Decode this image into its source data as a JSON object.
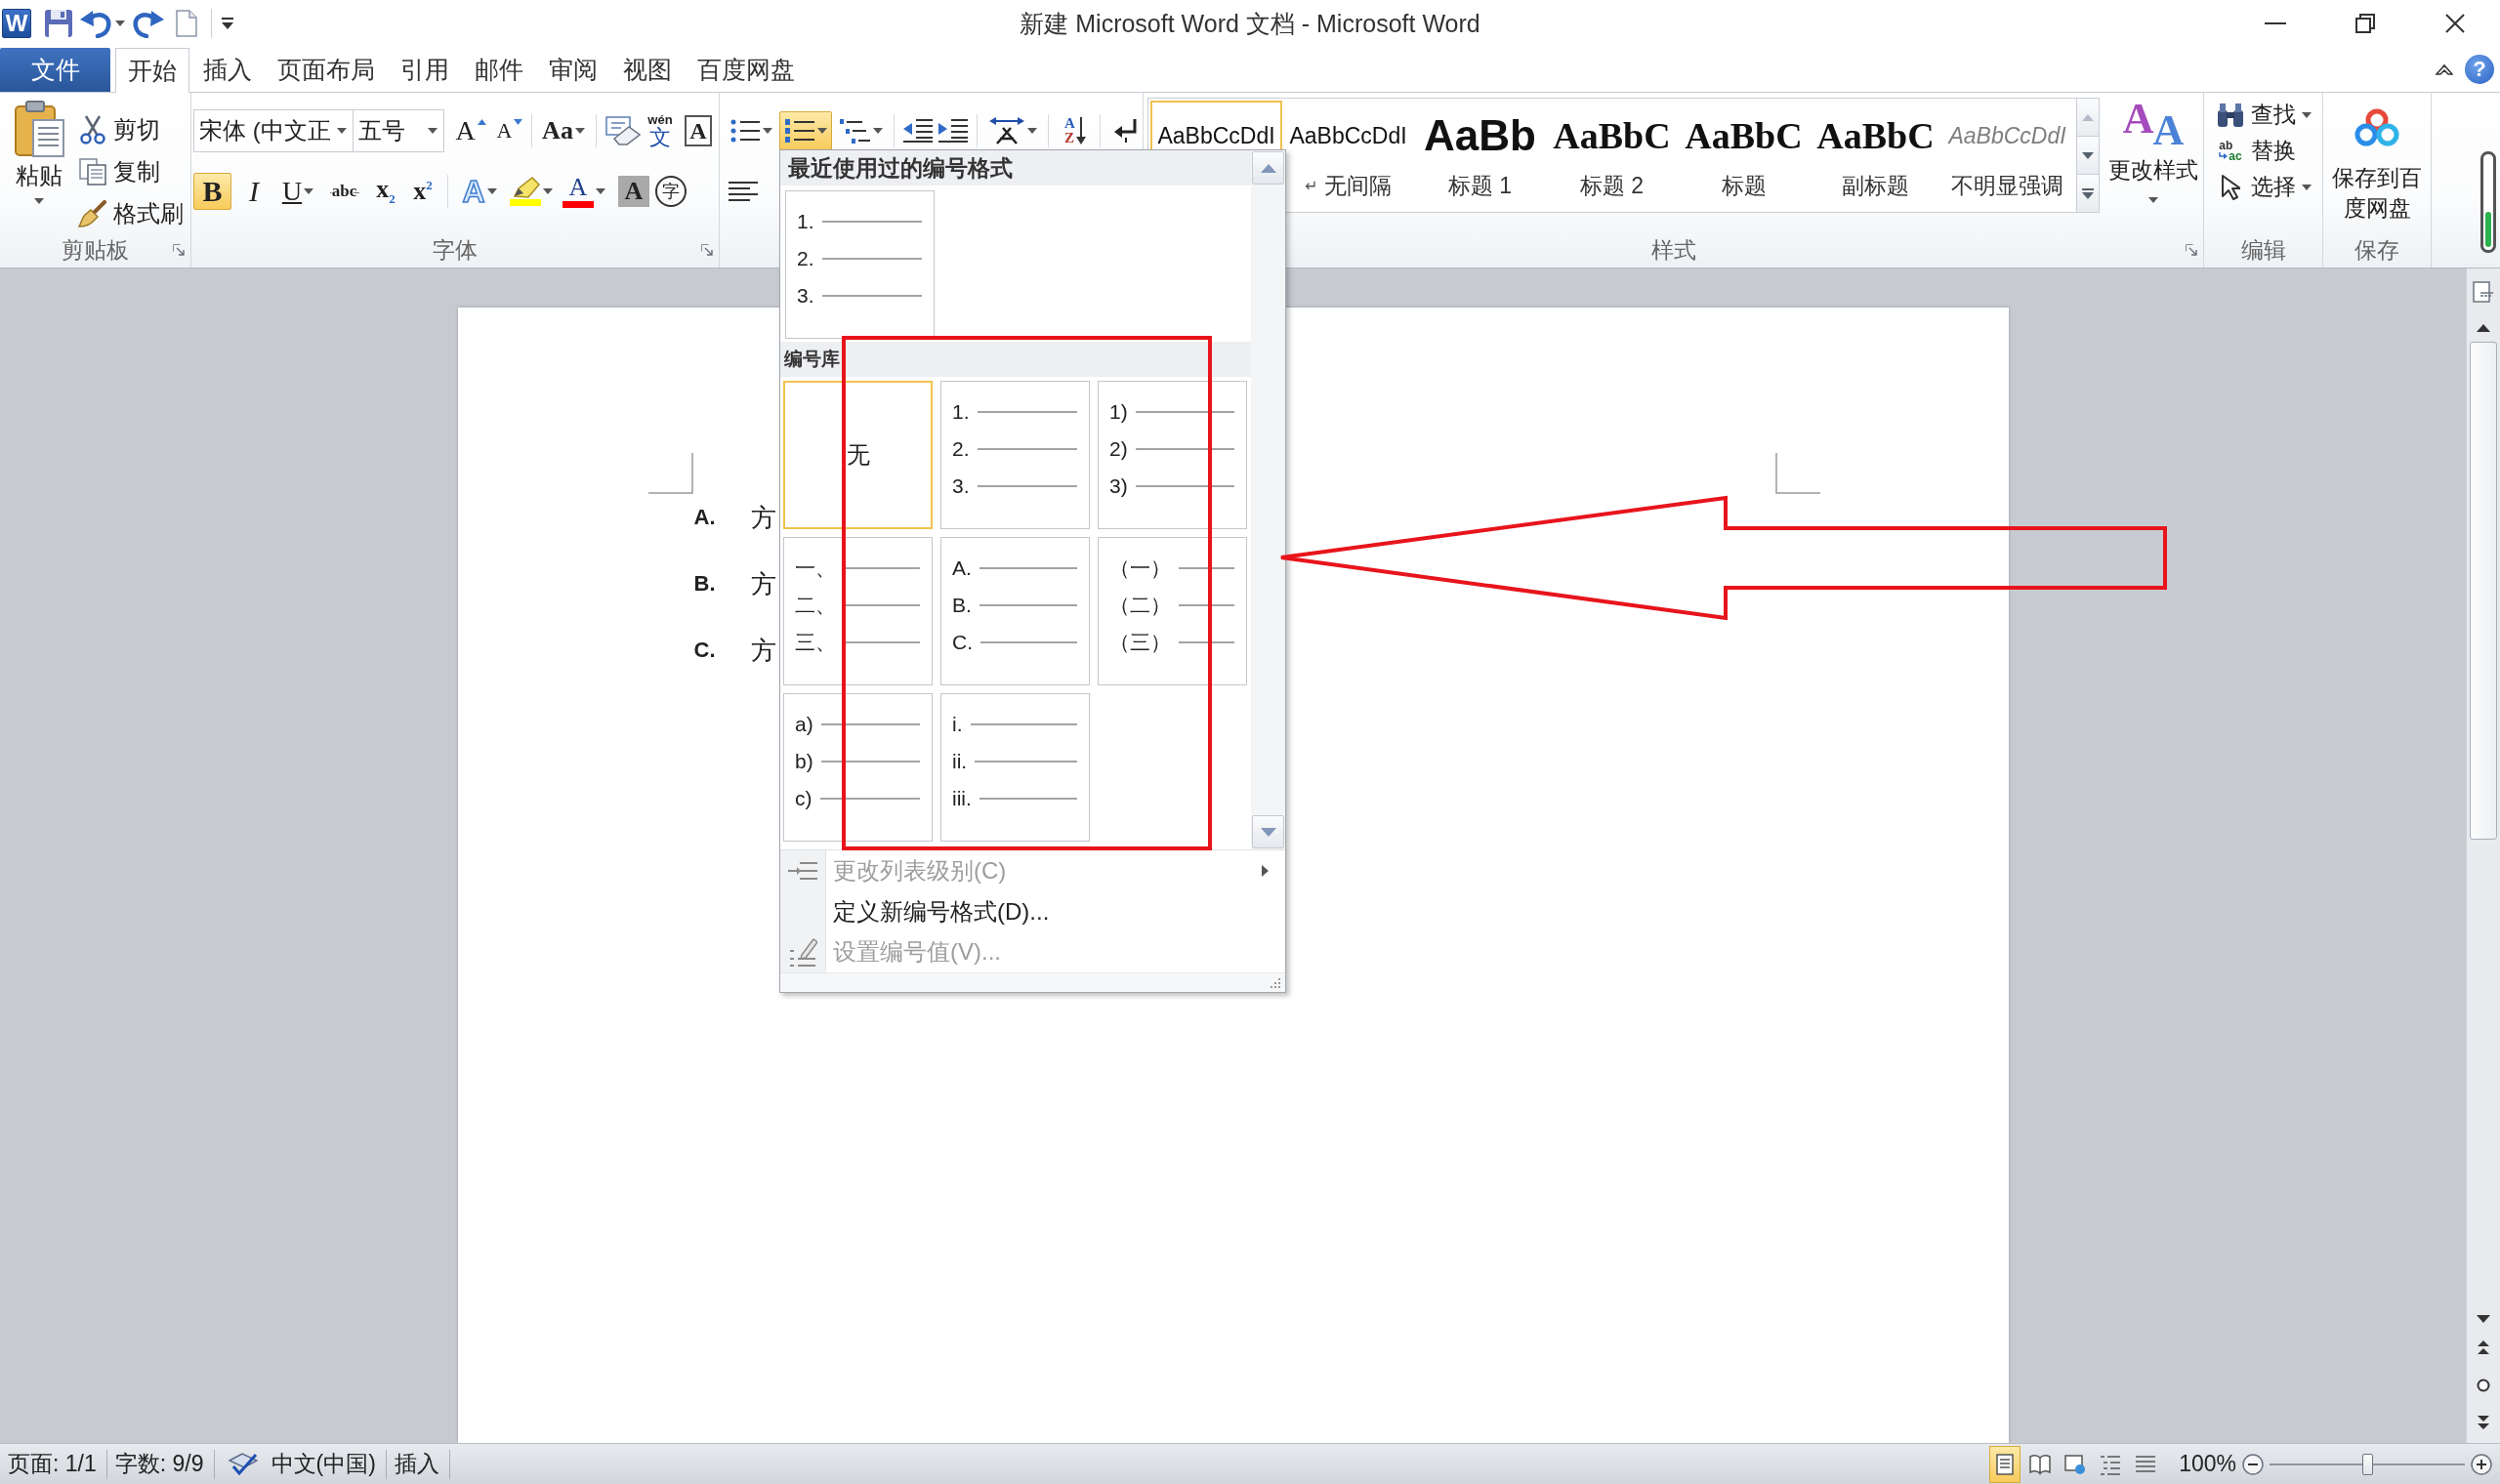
{
  "window": {
    "title": "新建 Microsoft Word 文档 - Microsoft Word",
    "logo": "W",
    "help": "?"
  },
  "tabs": [
    {
      "label": "文件",
      "kind": "file",
      "selected": false
    },
    {
      "label": "开始",
      "kind": "tab",
      "selected": true
    },
    {
      "label": "插入",
      "kind": "tab",
      "selected": false
    },
    {
      "label": "页面布局",
      "kind": "tab",
      "selected": false
    },
    {
      "label": "引用",
      "kind": "tab",
      "selected": false
    },
    {
      "label": "邮件",
      "kind": "tab",
      "selected": false
    },
    {
      "label": "审阅",
      "kind": "tab",
      "selected": false
    },
    {
      "label": "视图",
      "kind": "tab",
      "selected": false
    },
    {
      "label": "百度网盘",
      "kind": "tab",
      "selected": false
    }
  ],
  "clipboard": {
    "label": "剪贴板",
    "paste": "粘贴",
    "commands": [
      {
        "kind": "cut",
        "label": "剪切"
      },
      {
        "kind": "copy",
        "label": "复制"
      },
      {
        "kind": "format_painter",
        "label": "格式刷"
      }
    ]
  },
  "font": {
    "label": "字体",
    "font_name": "宋体 (中文正",
    "font_size": "五号",
    "size_buttons": [
      {
        "kind": "grow",
        "glyph": "A"
      },
      {
        "kind": "shrink",
        "glyph": "A"
      },
      {
        "kind": "case",
        "glyph": "Aa"
      },
      {
        "kind": "clear"
      },
      {
        "kind": "phonetic",
        "glyph": "文",
        "ruby": "wén"
      },
      {
        "kind": "border",
        "glyph": "A"
      }
    ],
    "format_buttons": [
      {
        "kind": "bold",
        "glyph": "B",
        "on": true
      },
      {
        "kind": "italic",
        "glyph": "I",
        "on": false
      },
      {
        "kind": "underline",
        "glyph": "U",
        "on": false
      },
      {
        "kind": "strike",
        "glyph": "abc",
        "on": false
      },
      {
        "kind": "subscript",
        "glyph": "x$_{2}$",
        "on": false
      },
      {
        "kind": "superscript",
        "glyph": "x$^{2}$",
        "on": false
      }
    ],
    "effect_buttons": [
      {
        "kind": "effects",
        "glyph": "A"
      },
      {
        "kind": "highlight",
        "color": "#ffff00"
      },
      {
        "kind": "color",
        "glyph": "A",
        "color": "#ff0000"
      },
      {
        "kind": "shading",
        "glyph": "A"
      },
      {
        "kind": "enclose",
        "glyph": "字"
      }
    ]
  },
  "paragraph": {
    "buttons": [
      {
        "kind": "bullets",
        "on": false
      },
      {
        "kind": "numbering",
        "on": true
      },
      {
        "kind": "multilevel",
        "on": false
      },
      {
        "kind": "decrease_indent",
        "on": false
      },
      {
        "kind": "increase_indent",
        "on": false
      },
      {
        "kind": "asian_layout",
        "on": false
      },
      {
        "kind": "sort",
        "glyph": "A",
        "glyph2": "Z",
        "on": false
      },
      {
        "kind": "marks",
        "on": false
      },
      {
        "kind": "align_left",
        "on": false
      }
    ]
  },
  "styles": {
    "label": "样式",
    "gallery": [
      {
        "kind": "normal",
        "sample": "AaBbCcDdI",
        "selected": true
      },
      {
        "kind": "normal",
        "sample": "AaBbCcDdI",
        "mark": "↵",
        "label": "无间隔",
        "selected": false
      },
      {
        "kind": "heading1",
        "sample": "AaBb",
        "label": "标题 1",
        "selected": false
      },
      {
        "kind": "heading2",
        "sample": "AaBbC",
        "label": "标题 2",
        "selected": false
      },
      {
        "kind": "title",
        "sample": "AaBbC",
        "label": "标题",
        "selected": false
      },
      {
        "kind": "subtitle",
        "sample": "AaBbC",
        "label": "副标题",
        "selected": false
      },
      {
        "kind": "subtle",
        "sample": "AaBbCcDdI",
        "label": "不明显强调",
        "selected": false
      }
    ],
    "change_styles": {
      "glyphs": [
        "A",
        "A"
      ],
      "label": "更改样式"
    }
  },
  "editing": {
    "label": "编辑",
    "commands": [
      {
        "kind": "find",
        "label": "查找",
        "dropdown": true
      },
      {
        "kind": "replace",
        "glyphs": [
          "ab",
          "ac"
        ],
        "label": "替换",
        "dropdown": false
      },
      {
        "kind": "select",
        "label": "选择",
        "dropdown": true
      }
    ]
  },
  "save": {
    "label": "保存",
    "button": "保存到百度网盘"
  },
  "numbering_menu": {
    "recent_heading": "最近使用过的编号格式",
    "recent": [
      {
        "kind": "list",
        "markers": [
          "1.",
          "2.",
          "3."
        ]
      }
    ],
    "library_heading": "编号库",
    "library": [
      {
        "kind": "none",
        "text": "无",
        "selected": true
      },
      {
        "kind": "list",
        "markers": [
          "1.",
          "2.",
          "3."
        ],
        "selected": false
      },
      {
        "kind": "list",
        "markers": [
          "1)",
          "2)",
          "3)"
        ],
        "selected": false
      },
      {
        "kind": "list",
        "markers": [
          "一、",
          "二、",
          "三、"
        ],
        "selected": false
      },
      {
        "kind": "list",
        "markers": [
          "A.",
          "B.",
          "C."
        ],
        "selected": false
      },
      {
        "kind": "list",
        "markers": [
          "（一）",
          "（二）",
          "（三）"
        ],
        "selected": false
      },
      {
        "kind": "list",
        "markers": [
          "a)",
          "b)",
          "c)"
        ],
        "selected": false
      },
      {
        "kind": "list",
        "markers": [
          "i.",
          "ii.",
          "iii."
        ],
        "selected": false
      }
    ],
    "commands": [
      {
        "kind": "list_level",
        "label": "更改列表级别(C)",
        "disabled": true,
        "submenu": true
      },
      {
        "kind": "define",
        "label": "定义新编号格式(D)...",
        "disabled": false,
        "submenu": false
      },
      {
        "kind": "set_value",
        "label": "设置编号值(V)...",
        "disabled": true,
        "submenu": false
      }
    ]
  },
  "document": {
    "items": [
      {
        "marker": "A.",
        "text": "方"
      },
      {
        "marker": "B.",
        "text": "方"
      },
      {
        "marker": "C.",
        "text": "方"
      }
    ]
  },
  "status_bar": {
    "page": "页面: 1/1",
    "words": "字数: 9/9",
    "language": "中文(中国)",
    "mode": "插入",
    "views": [
      {
        "kind": "print",
        "selected": true
      },
      {
        "kind": "reading",
        "selected": false
      },
      {
        "kind": "web",
        "selected": false
      },
      {
        "kind": "outline",
        "selected": false
      },
      {
        "kind": "draft",
        "selected": false
      }
    ],
    "zoom": "100%",
    "zoom_slider": {
      "level": 0.5
    }
  },
  "annotations": [
    {
      "kind": "rectangle"
    },
    {
      "kind": "arrow"
    }
  ]
}
